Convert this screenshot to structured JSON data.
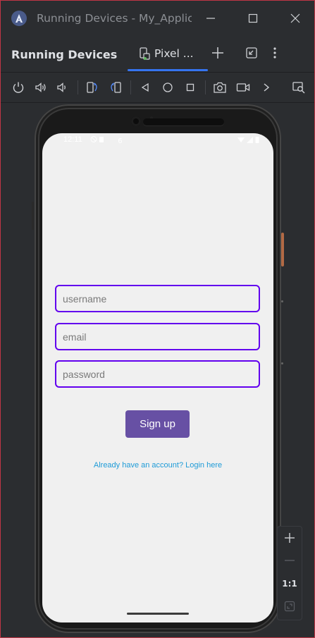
{
  "window": {
    "title": "Running Devices - My_Applic",
    "logo_icon": "android-studio-icon",
    "controls": [
      "minimize-icon",
      "maximize-icon",
      "close-icon"
    ]
  },
  "tool_window": {
    "title": "Running Devices",
    "tab": {
      "label": "Pixel ...",
      "icon": "phone-device-icon",
      "accent": "#3574f0"
    },
    "header_actions": [
      "add-icon",
      "hide-icon",
      "more-options-icon"
    ]
  },
  "toolbar": {
    "buttons": [
      "power-icon",
      "volume-up-icon",
      "volume-down-icon",
      "rotate-left-icon",
      "rotate-right-icon",
      "back-icon",
      "home-icon",
      "overview-icon",
      "screenshot-icon",
      "screen-record-icon",
      "chevron-right-icon",
      "zoom-search-icon"
    ]
  },
  "device": {
    "status_bar": {
      "time": "12:11",
      "extra": "6"
    },
    "form": {
      "username_placeholder": "username",
      "email_placeholder": "email",
      "password_placeholder": "password",
      "signup_label": "Sign up",
      "login_link": "Already have an account? Login here"
    },
    "colors": {
      "field_border": "#6200ee",
      "button": "#6750a4",
      "link": "#1e9bd7"
    }
  },
  "zoom": {
    "actual_size_label": "1:1"
  }
}
